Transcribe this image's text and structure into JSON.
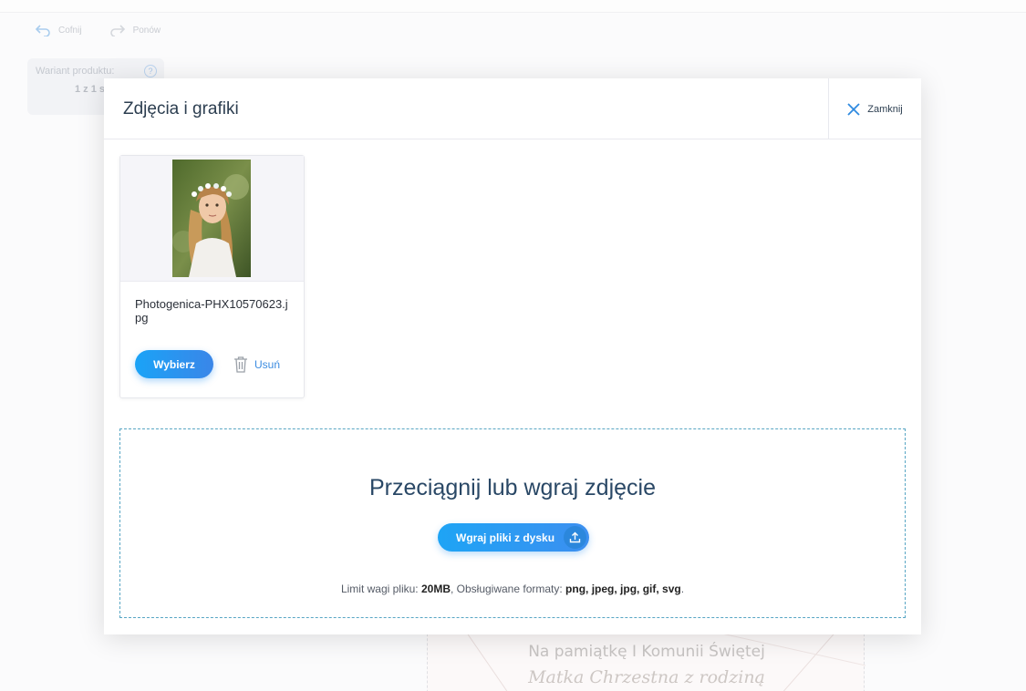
{
  "background": {
    "undo_label": "Cofnij",
    "redo_label": "Ponów",
    "variant_label": "Wariant produktu:",
    "variant_help": "?",
    "variant_count": "1 z 1 s",
    "canvas_text1": "Na pamiątkę I Komunii Świętej",
    "canvas_text2": "Matka Chrzestna z rodziną"
  },
  "modal": {
    "title": "Zdjęcia i grafiki",
    "close_label": "Zamknij"
  },
  "gallery": {
    "items": [
      {
        "filename": "Photogenica-PHX10570623.jpg",
        "select_label": "Wybierz",
        "delete_label": "Usuń"
      }
    ]
  },
  "upload": {
    "title": "Przeciągnij lub wgraj zdjęcie",
    "button_label": "Wgraj pliki z dysku",
    "limit_label": "Limit wagi pliku: ",
    "limit_value": "20MB",
    "formats_label": ", Obsługiwane formaty: ",
    "formats_value": "png, jpeg, jpg, gif, svg",
    "trailing": "."
  },
  "colors": {
    "accent": "#1aa3f7",
    "accent_dark": "#2b87dc",
    "dropzone_border": "#58a6c4",
    "title_text": "#2c3e50"
  },
  "icons": {
    "undo": "undo-icon",
    "redo": "redo-icon",
    "close": "close-icon",
    "trash": "trash-icon",
    "upload": "upload-icon",
    "help": "help-icon"
  }
}
